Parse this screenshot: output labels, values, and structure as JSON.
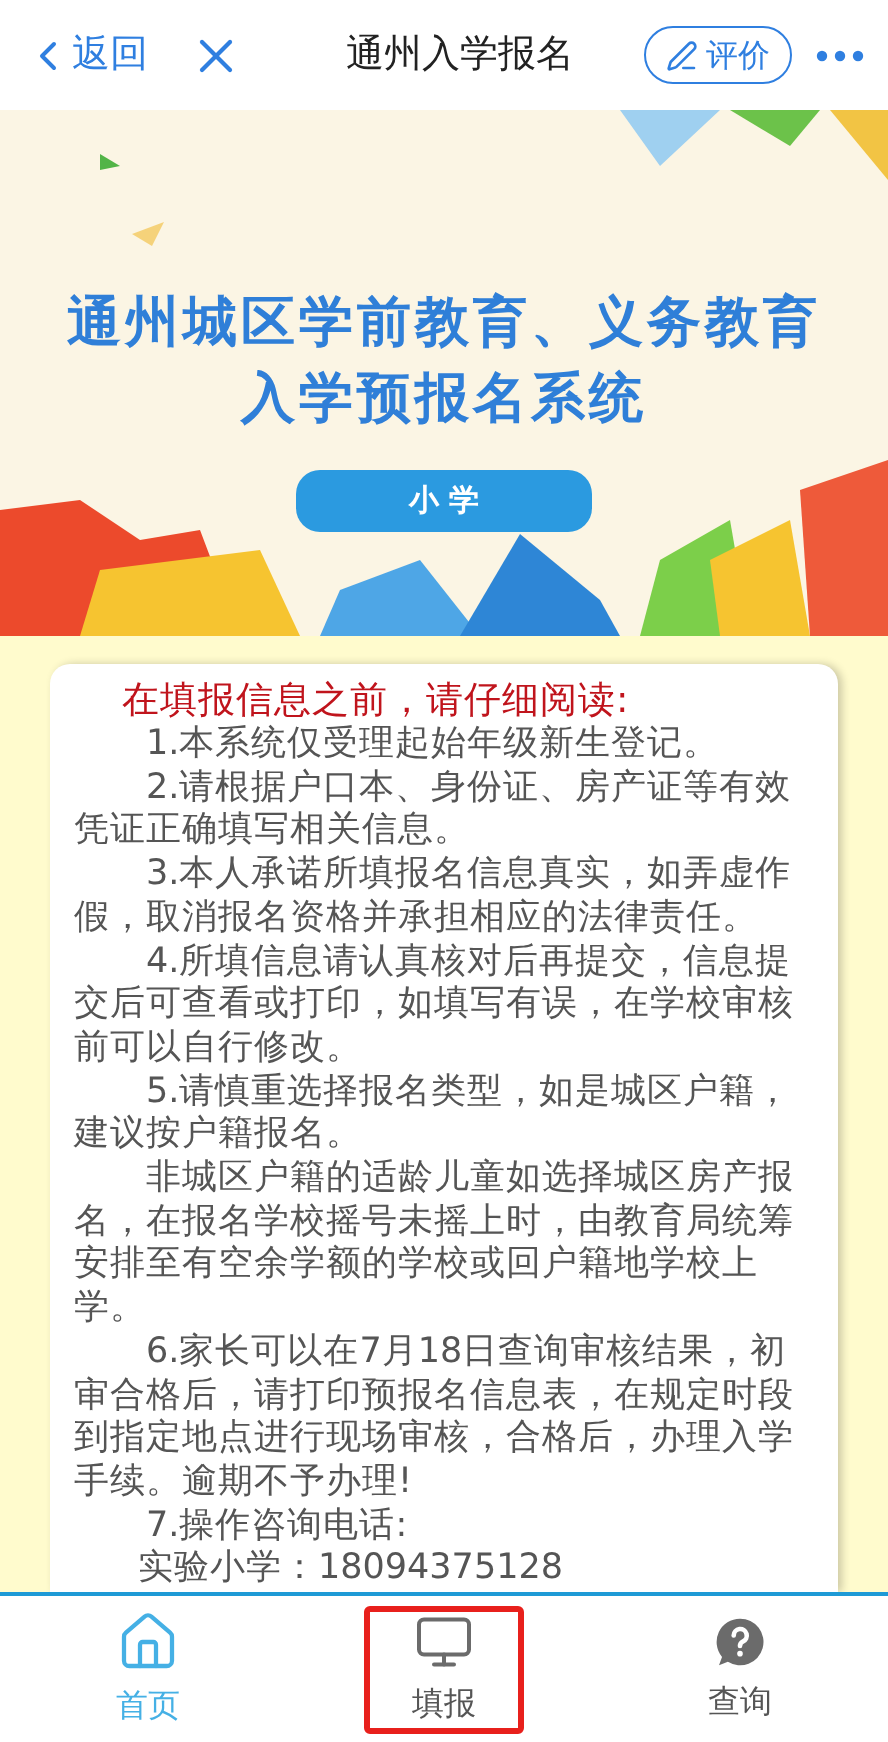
{
  "header": {
    "back": "返回",
    "title": "通州入学报名",
    "rate": "评价"
  },
  "banner": {
    "title_lines": [
      "通州城区学前教育、义务教育",
      "入学预报名系统"
    ],
    "badge": "小 学"
  },
  "notice": {
    "heading": "在填报信息之前，请仔细阅读:",
    "paragraphs": [
      {
        "kind": "item",
        "text": "1.本系统仅受理起始年级新生登记。"
      },
      {
        "kind": "item",
        "text": "2.请根据户口本、身份证、房产证等有效凭证正确填写相关信息。"
      },
      {
        "kind": "item",
        "text": "3.本人承诺所填报名信息真实，如弄虚作假，取消报名资格并承担相应的法律责任。"
      },
      {
        "kind": "item",
        "text": "4.所填信息请认真核对后再提交，信息提交后可查看或打印，如填写有误，在学校审核前可以自行修改。"
      },
      {
        "kind": "item",
        "text": "5.请慎重选择报名类型，如是城区户籍，建议按户籍报名。"
      },
      {
        "kind": "item",
        "text": "非城区户籍的适龄儿童如选择城区房产报名，在报名学校摇号未摇上时，由教育局统筹安排至有空余学额的学校或回户籍地学校上学。"
      },
      {
        "kind": "item",
        "text": "6.家长可以在7月18日查询审核结果，初审合格后，请打印预报名信息表，在规定时段到指定地点进行现场审核，合格后，办理入学手续。逾期不予办理!"
      },
      {
        "kind": "item",
        "text": "7.操作咨询电话:"
      },
      {
        "kind": "contact",
        "text": "实验小学：18094375128"
      }
    ]
  },
  "tabs": [
    {
      "label": "首页",
      "kind": "home",
      "selected": true,
      "outlined": false
    },
    {
      "label": "填报",
      "kind": "monitor",
      "selected": false,
      "outlined": true
    },
    {
      "label": "查询",
      "kind": "help",
      "selected": false,
      "outlined": false
    }
  ]
}
